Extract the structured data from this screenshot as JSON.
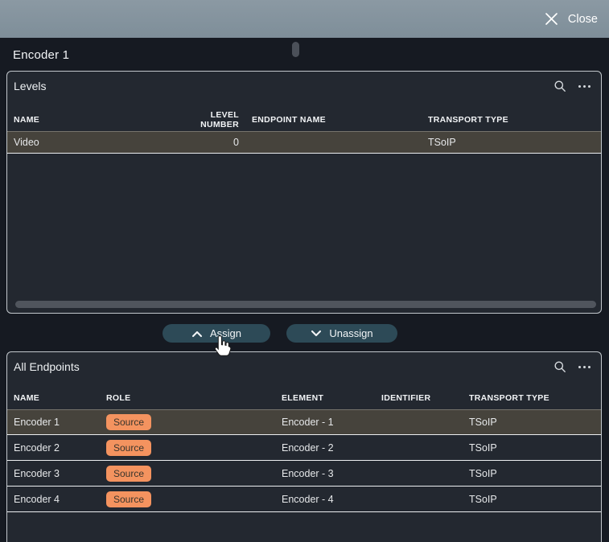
{
  "topbar": {
    "close_label": "Close"
  },
  "page": {
    "title": "Encoder 1"
  },
  "levels_panel": {
    "title": "Levels",
    "columns": [
      "NAME",
      "LEVEL NUMBER",
      "ENDPOINT NAME",
      "TRANSPORT TYPE"
    ],
    "rows": [
      {
        "name": "Video",
        "level_number": "0",
        "endpoint_name": "",
        "transport_type": "TSoIP",
        "selected": true
      }
    ]
  },
  "actions": {
    "assign_label": "Assign",
    "unassign_label": "Unassign"
  },
  "endpoints_panel": {
    "title": "All Endpoints",
    "columns": [
      "NAME",
      "ROLE",
      "ELEMENT",
      "IDENTIFIER",
      "TRANSPORT TYPE"
    ],
    "rows": [
      {
        "name": "Encoder 1",
        "role": "Source",
        "element": "Encoder - 1",
        "identifier": "",
        "transport_type": "TSoIP",
        "selected": true
      },
      {
        "name": "Encoder 2",
        "role": "Source",
        "element": "Encoder - 2",
        "identifier": "",
        "transport_type": "TSoIP",
        "selected": false
      },
      {
        "name": "Encoder 3",
        "role": "Source",
        "element": "Encoder - 3",
        "identifier": "",
        "transport_type": "TSoIP",
        "selected": false
      },
      {
        "name": "Encoder 4",
        "role": "Source",
        "element": "Encoder - 4",
        "identifier": "",
        "transport_type": "TSoIP",
        "selected": false
      }
    ]
  },
  "icons": {
    "close": "close-x",
    "search": "magnifier",
    "more": "ellipsis",
    "assign": "chevron-up",
    "unassign": "chevron-down",
    "cursor": "hand-pointer",
    "drag_handle": "grab-pill"
  },
  "colors": {
    "topbar_bg": "#84949e",
    "page_bg": "#161a22",
    "panel_bg": "#232830",
    "panel_border": "#c3c8cd",
    "selected_row_bg": "#46433c",
    "row_divider": "#edeff1",
    "badge_bg": "#f4935f",
    "button_bg": "#2d4a57",
    "scrollbar_thumb": "#50555d"
  }
}
